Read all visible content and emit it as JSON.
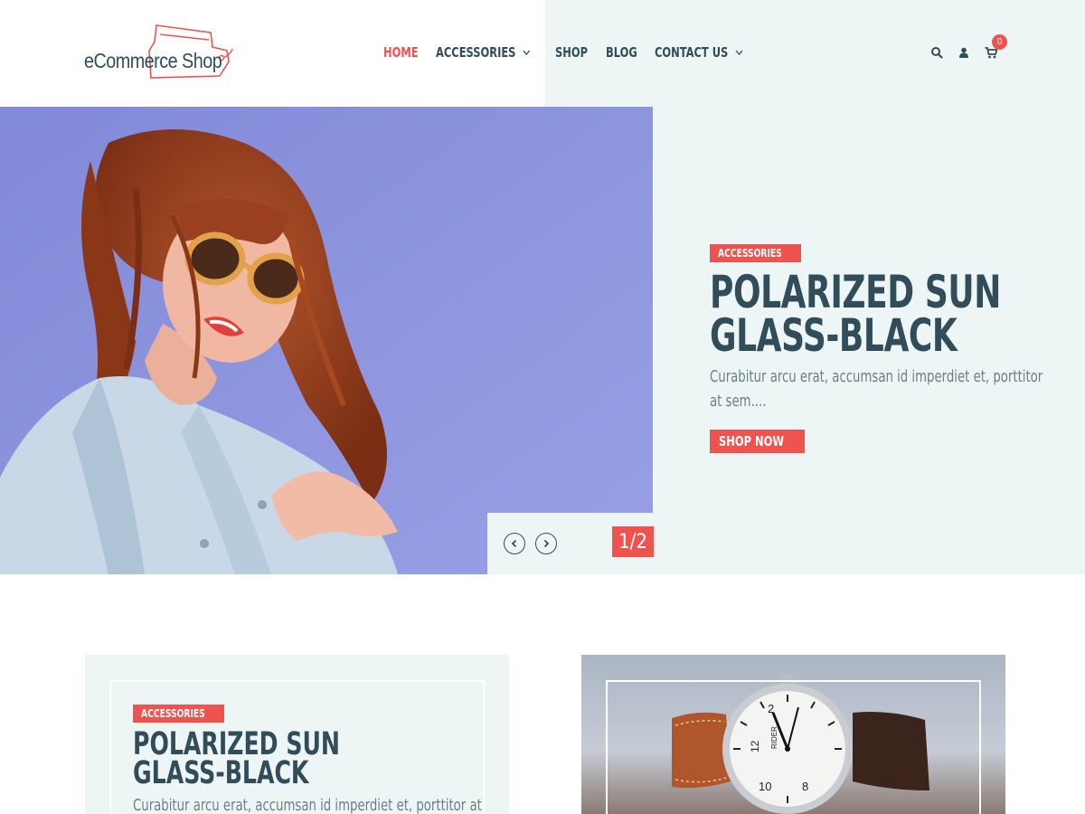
{
  "brand": {
    "logo_text": "eCommerce Shop"
  },
  "nav": {
    "items": [
      {
        "label": "HOME",
        "active": true,
        "dropdown": false
      },
      {
        "label": "ACCESSORIES",
        "active": false,
        "dropdown": true
      },
      {
        "label": "SHOP",
        "active": false,
        "dropdown": false
      },
      {
        "label": "BLOG",
        "active": false,
        "dropdown": false
      },
      {
        "label": "CONTACT US",
        "active": false,
        "dropdown": true
      }
    ]
  },
  "header_icons": {
    "search": "search-icon",
    "account": "user-icon",
    "cart": "cart-icon",
    "cart_count": "0"
  },
  "hero": {
    "tag": "ACCESSORIES",
    "title": "POLARIZED SUN GLASS-BLACK",
    "description": "Curabitur arcu erat, accumsan id imperdiet et, porttitor at sem....",
    "button": "SHOP NOW",
    "slide_counter": "1/2"
  },
  "featured": {
    "tag": "ACCESSORIES",
    "title": "POLARIZED SUN GLASS-BLACK",
    "description": "Curabitur arcu erat, accumsan id imperdiet et, porttitor at",
    "watch_brand": "RIDER"
  },
  "colors": {
    "accent": "#ef5350",
    "text": "#324d5a",
    "muted": "#6b7f89",
    "panel": "#eef6f5",
    "hero_bg": "#8d94dc"
  }
}
